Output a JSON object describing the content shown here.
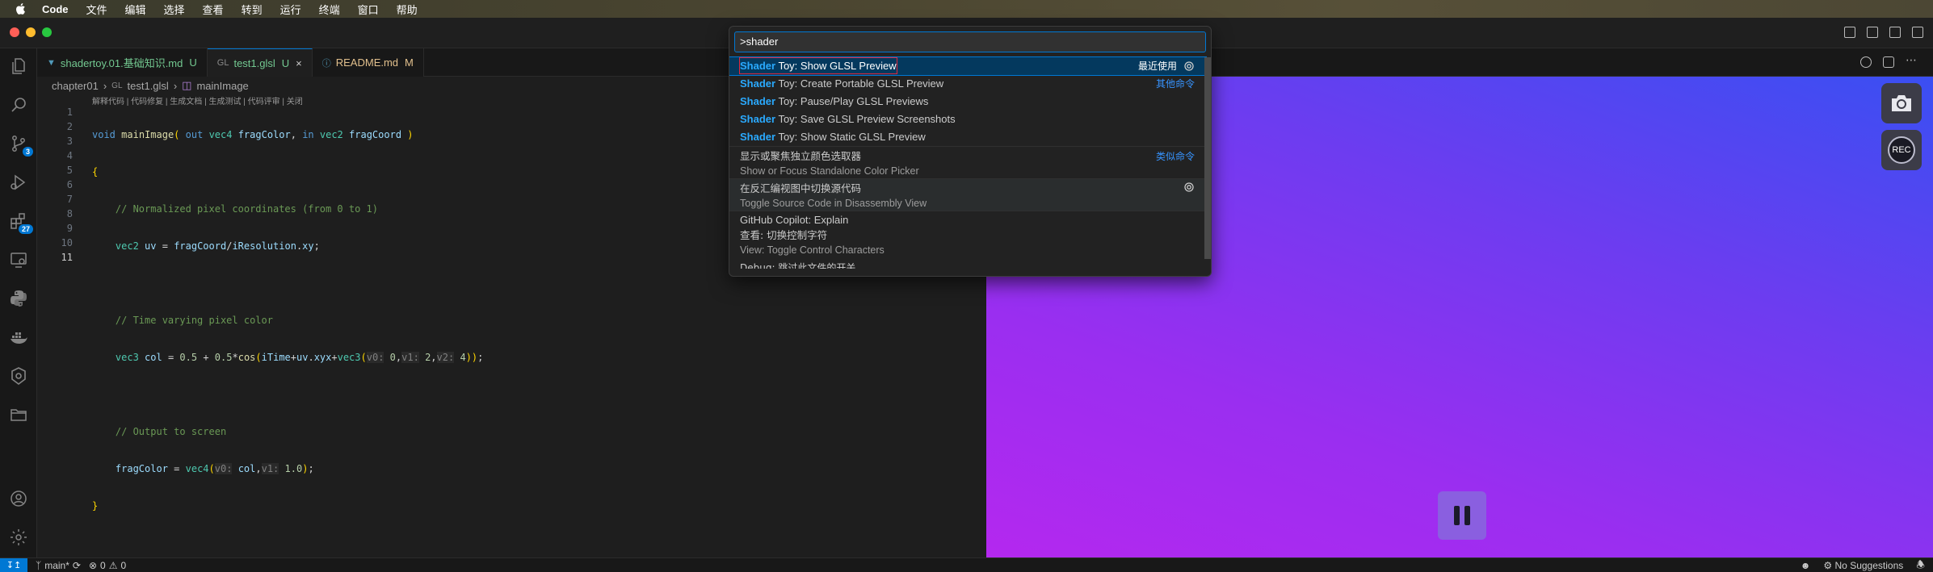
{
  "menubar": {
    "items": [
      "Code",
      "文件",
      "编辑",
      "选择",
      "查看",
      "转到",
      "运行",
      "终端",
      "窗口",
      "帮助"
    ]
  },
  "activity": {
    "scm_badge": "3",
    "extensions_badge": "27"
  },
  "tabs": [
    {
      "icon": "markdown-icon",
      "label": "shadertoy.01.基础知识.md",
      "status": "U"
    },
    {
      "icon": "glsl-icon",
      "prefix": "GL",
      "label": "test1.glsl",
      "status": "U"
    },
    {
      "icon": "info-icon",
      "label": "README.md",
      "status": "M"
    }
  ],
  "breadcrumb": {
    "folder": "chapter01",
    "file_prefix": "GL",
    "file": "test1.glsl",
    "symbol": "mainImage"
  },
  "codelens": "解释代码 | 代码修复 | 生成文档 | 生成测试 | 代码评审 | 关闭",
  "code": {
    "line_numbers": [
      "1",
      "2",
      "3",
      "4",
      "5",
      "6",
      "7",
      "8",
      "9",
      "10",
      "11"
    ],
    "current_line": "11"
  },
  "palette": {
    "query": ">shader",
    "items": [
      {
        "prefix": "Shader",
        "rest": " Toy: Show GLSL Preview",
        "right": "最近使用",
        "selected": true
      },
      {
        "prefix": "Shader",
        "rest": " Toy: Create Portable GLSL Preview",
        "right": "其他命令"
      },
      {
        "prefix": "Shader",
        "rest": " Toy: Pause/Play GLSL Previews",
        "right": ""
      },
      {
        "prefix": "Shader",
        "rest": " Toy: Save GLSL Preview Screenshots",
        "right": ""
      },
      {
        "prefix": "Shader",
        "rest": " Toy: Show Static GLSL Preview",
        "right": ""
      }
    ],
    "two_line_items": [
      {
        "l1": "显示或聚焦独立颜色选取器",
        "l2": "Show or Focus Standalone Color Picker",
        "right": "类似命令"
      },
      {
        "l1": "在反汇编视图中切换源代码",
        "l2": "Toggle Source Code in Disassembly View",
        "right": ""
      }
    ],
    "single_item": "GitHub Copilot: Explain",
    "view_item": {
      "l1": "查看: 切换控制字符",
      "l2": "View: Toggle Control Characters"
    },
    "partial_item": "Debug: 跳过此文件的开关"
  },
  "preview": {
    "rec_label": "REC"
  },
  "statusbar": {
    "branch": "main*",
    "errors": "0",
    "warnings": "0",
    "suggestions": "No Suggestions"
  },
  "colors": {
    "accent": "#0078d4",
    "highlight": "#2aaaff",
    "selection_outline": "#e0283c"
  }
}
